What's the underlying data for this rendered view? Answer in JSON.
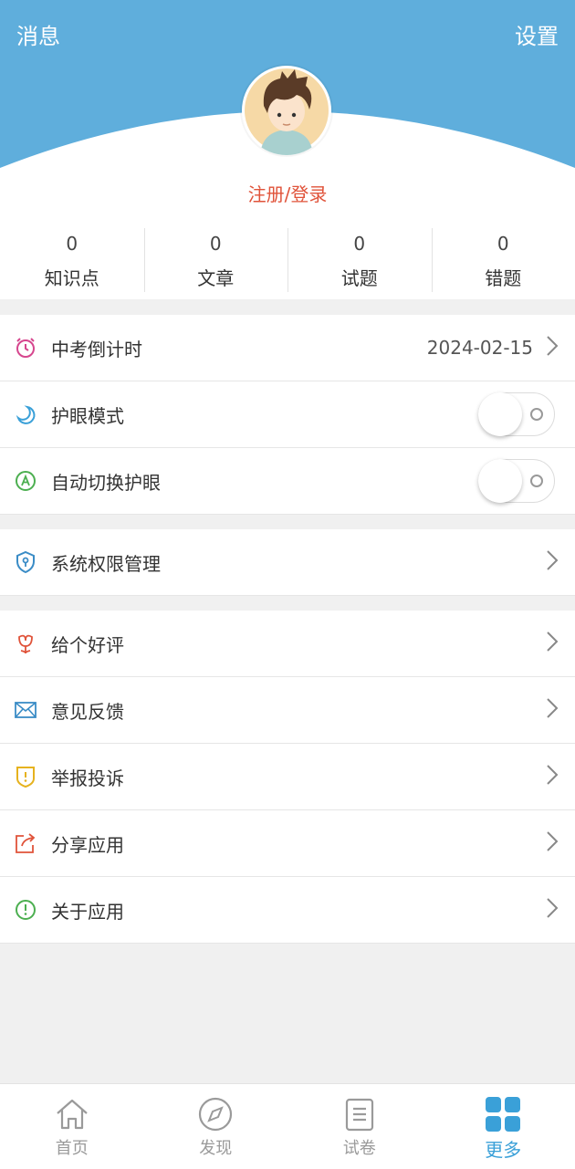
{
  "header": {
    "messages_label": "消息",
    "settings_label": "设置",
    "login_label": "注册/登录"
  },
  "stats": [
    {
      "value": "0",
      "label": "知识点"
    },
    {
      "value": "0",
      "label": "文章"
    },
    {
      "value": "0",
      "label": "试题"
    },
    {
      "value": "0",
      "label": "错题"
    }
  ],
  "group1": {
    "countdown": {
      "label": "中考倒计时",
      "value": "2024-02-15",
      "icon": "alarm-clock-icon"
    },
    "eye_mode": {
      "label": "护眼模式",
      "icon": "moon-icon",
      "enabled": false
    },
    "auto_eye": {
      "label": "自动切换护眼",
      "icon": "auto-switch-icon",
      "enabled": false
    }
  },
  "group2": {
    "permissions": {
      "label": "系统权限管理",
      "icon": "shield-key-icon"
    }
  },
  "group3": {
    "items": [
      {
        "label": "给个好评",
        "icon": "flower-icon"
      },
      {
        "label": "意见反馈",
        "icon": "envelope-icon"
      },
      {
        "label": "举报投诉",
        "icon": "report-shield-icon"
      },
      {
        "label": "分享应用",
        "icon": "share-icon"
      },
      {
        "label": "关于应用",
        "icon": "info-icon"
      }
    ]
  },
  "tabs": [
    {
      "label": "首页",
      "icon": "home-icon"
    },
    {
      "label": "发现",
      "icon": "compass-icon"
    },
    {
      "label": "试卷",
      "icon": "document-icon"
    },
    {
      "label": "更多",
      "icon": "grid-icon",
      "active": true
    }
  ],
  "colors": {
    "header_blue": "#5faedc",
    "accent": "#3aa0d8",
    "login_red": "#e0533a"
  }
}
